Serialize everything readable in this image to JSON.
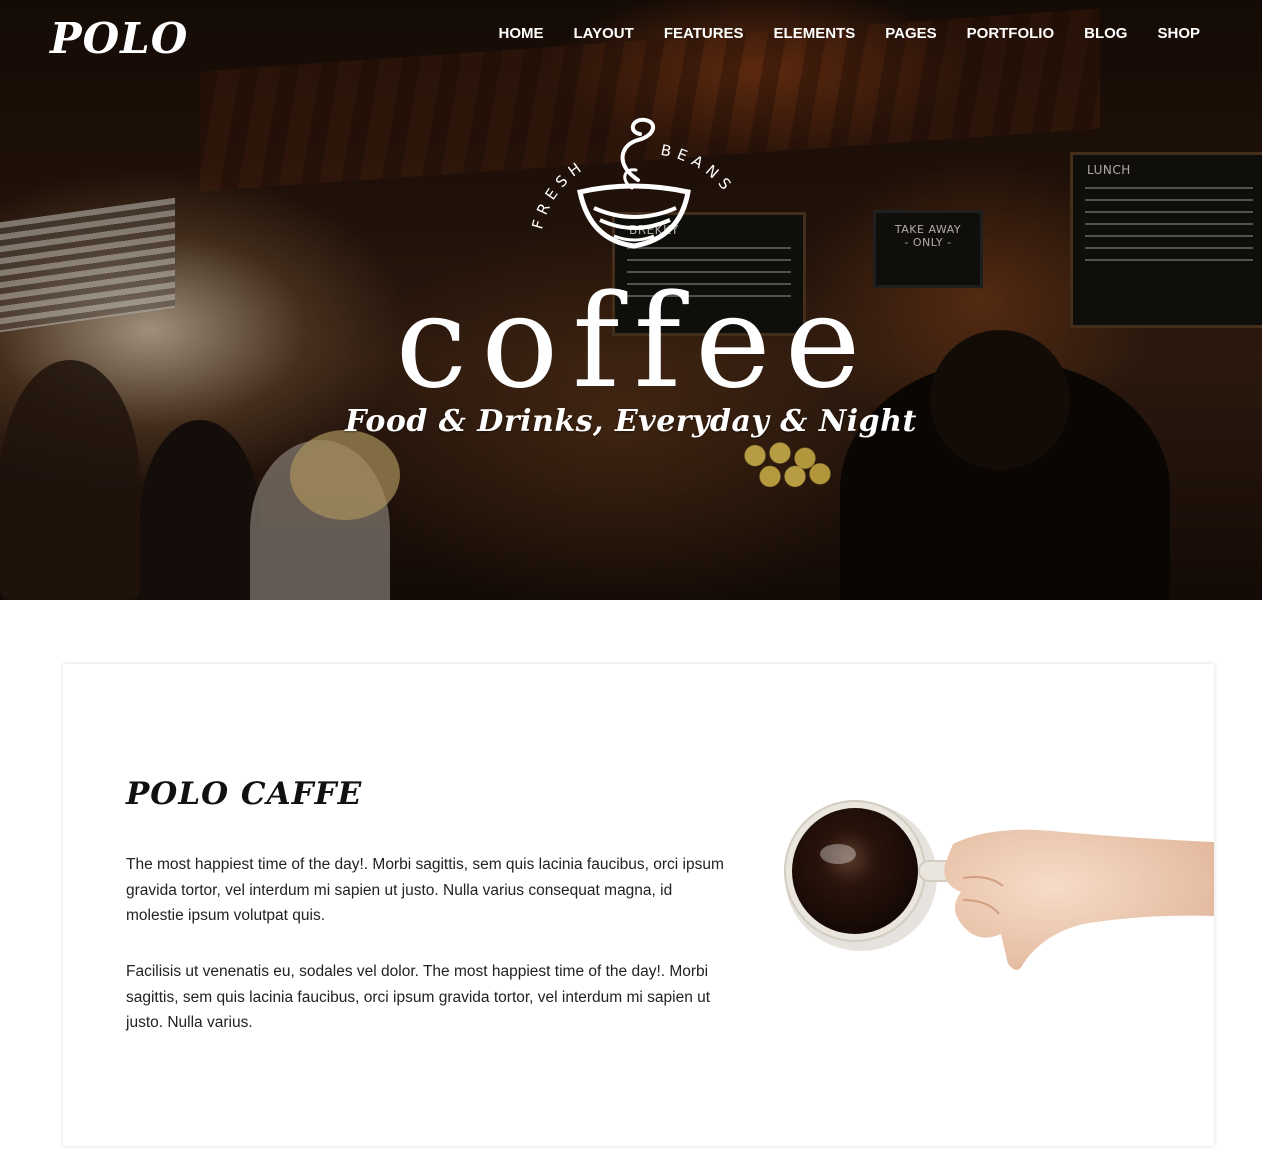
{
  "header": {
    "logo": "POLO",
    "nav": [
      "HOME",
      "LAYOUT",
      "FEATURES",
      "ELEMENTS",
      "PAGES",
      "PORTFOLIO",
      "BLOG",
      "SHOP"
    ]
  },
  "hero": {
    "emblem_arc_left": "FRESH",
    "emblem_arc_right": "BEANS",
    "title": "coffee",
    "tagline": "Food & Drinks, Everyday & Night",
    "boards": {
      "lunch": "LUNCH",
      "takeaway_line1": "TAKE AWAY",
      "takeaway_line2": "- ONLY -",
      "brekky": "BREKKY"
    }
  },
  "about": {
    "title": "POLO CAFFE",
    "paragraph1": "The most happiest time of the day!. Morbi sagittis, sem quis lacinia faucibus, orci ipsum gravida tortor, vel interdum mi sapien ut justo. Nulla varius consequat magna, id molestie ipsum volutpat quis.",
    "paragraph2": "Facilisis ut venenatis eu, sodales vel dolor. The most happiest time of the day!. Morbi sagittis, sem quis lacinia faucibus, orci ipsum gravida tortor, vel interdum mi sapien ut justo. Nulla varius."
  },
  "colors": {
    "text_light": "#ffffff",
    "text_dark": "#222222",
    "hero_base": "#2b170c",
    "card_bg": "#ffffff"
  }
}
